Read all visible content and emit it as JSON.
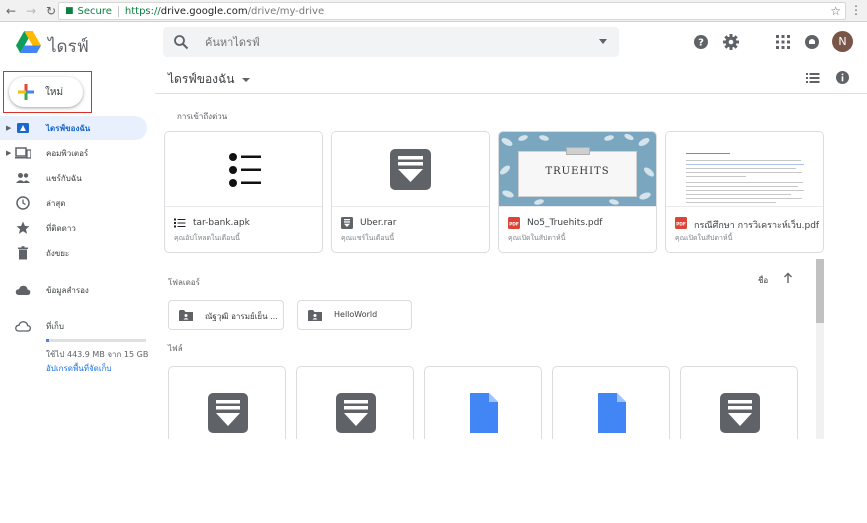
{
  "browser": {
    "secure_label": "Secure",
    "url_scheme": "https://",
    "url_host": "drive.google.com",
    "url_path": "/drive/my-drive"
  },
  "header": {
    "product_name": "ไดรฟ์",
    "search_placeholder": "ค้นหาไดรฟ์",
    "avatar_initial": "N"
  },
  "sidebar": {
    "new_label": "ใหม่",
    "items": [
      {
        "label": "ไดรฟ์ของฉัน",
        "icon": "my-drive-icon"
      },
      {
        "label": "คอมพิวเตอร์",
        "icon": "computer-icon"
      },
      {
        "label": "แชร์กับฉัน",
        "icon": "shared-icon"
      },
      {
        "label": "ล่าสุด",
        "icon": "recent-icon"
      },
      {
        "label": "ที่ติดดาว",
        "icon": "star-icon"
      },
      {
        "label": "ถังขยะ",
        "icon": "trash-icon"
      },
      {
        "label": "ข้อมูลสำรอง",
        "icon": "backup-icon"
      },
      {
        "label": "ที่เก็บ",
        "icon": "storage-icon"
      }
    ],
    "storage_used_fraction": 0.03,
    "storage_text": "ใช้ไป 443.9 MB จาก 15 GB",
    "upgrade_label": "อัปเกรดพื้นที่จัดเก็บ"
  },
  "main": {
    "breadcrumb": "ไดรฟ์ของฉัน",
    "quick_access_title": "การเข้าถึงด่วน",
    "quick_access": [
      {
        "name": "tar-bank.apk",
        "sub": "คุณอัปโหลดในเดือนนี้"
      },
      {
        "name": "Uber.rar",
        "sub": "คุณแชร์ในเดือนนี้"
      },
      {
        "name": "No5_Truehits.pdf",
        "sub": "คุณเปิดในสัปดาห์นี้"
      },
      {
        "name": "กรณีศึกษา การวิเคราะห์เว็บ.pdf",
        "sub": "คุณเปิดในสัปดาห์นี้"
      }
    ],
    "thumb_text": "TRUEHITS",
    "folders_title": "โฟลเดอร์",
    "sort_label": "ชื่อ",
    "folders": [
      "ณัฐวุฒิ อารมย์เย็น ...",
      "HelloWorld"
    ],
    "files_title": "ไฟล์"
  },
  "colors": {
    "accent": "#1967d2",
    "active_bg": "#e8f0fe",
    "pdf_red": "#db4437",
    "doc_blue": "#4285f4",
    "archive_gray": "#5f6368"
  }
}
